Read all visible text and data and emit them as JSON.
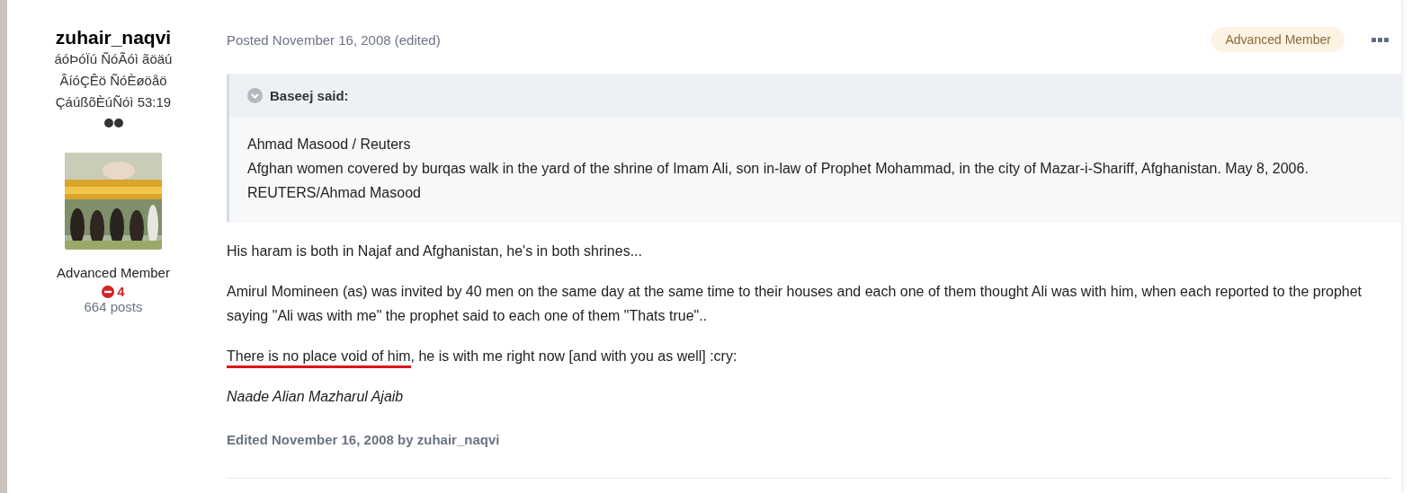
{
  "author": {
    "name": "zuhair_naqvi",
    "title_lines": [
      "áóÞóÏú ÑóÃóì ãöäú",
      "ÂíóÇÊö ÑóÈøöåö",
      "ÇáúßõÈúÑóì 53:19"
    ],
    "avatar": {
      "kind": "picture"
    },
    "group": "Advanced Member",
    "reputation": "4",
    "posts": "664 posts"
  },
  "post": {
    "meta": "Posted November 16, 2008 (edited)",
    "badge": "Advanced Member",
    "quote": {
      "citation": "Baseej said:",
      "lines": [
        "Ahmad Masood / Reuters",
        "Afghan women covered by burqas walk in the yard of the shrine of Imam Ali, son in-law of Prophet Mohammad, in the city of Mazar-i-Shariff, Afghanistan. May 8, 2006. REUTERS/Ahmad Masood"
      ]
    },
    "paragraphs": [
      {
        "kind": "plain",
        "text": "His haram is both in Najaf and Afghanistan, he's in both shrines..."
      },
      {
        "kind": "plain",
        "text": "Amirul Momineen (as) was invited by 40 men on the same day at the same time to their houses and each one of them thought Ali was with him, when each reported to the prophet saying \"Ali was with me\" the prophet said to each one of them \"Thats true\".."
      },
      {
        "kind": "marked",
        "underlined": "There is no place void of him",
        "text": ", he is with me right now [and with you as well] :cry:"
      },
      {
        "kind": "italic",
        "text": "Naade Alian Mazharul Ajaib"
      }
    ],
    "edited": "Edited November 16, 2008 by zuhair_naqvi"
  }
}
